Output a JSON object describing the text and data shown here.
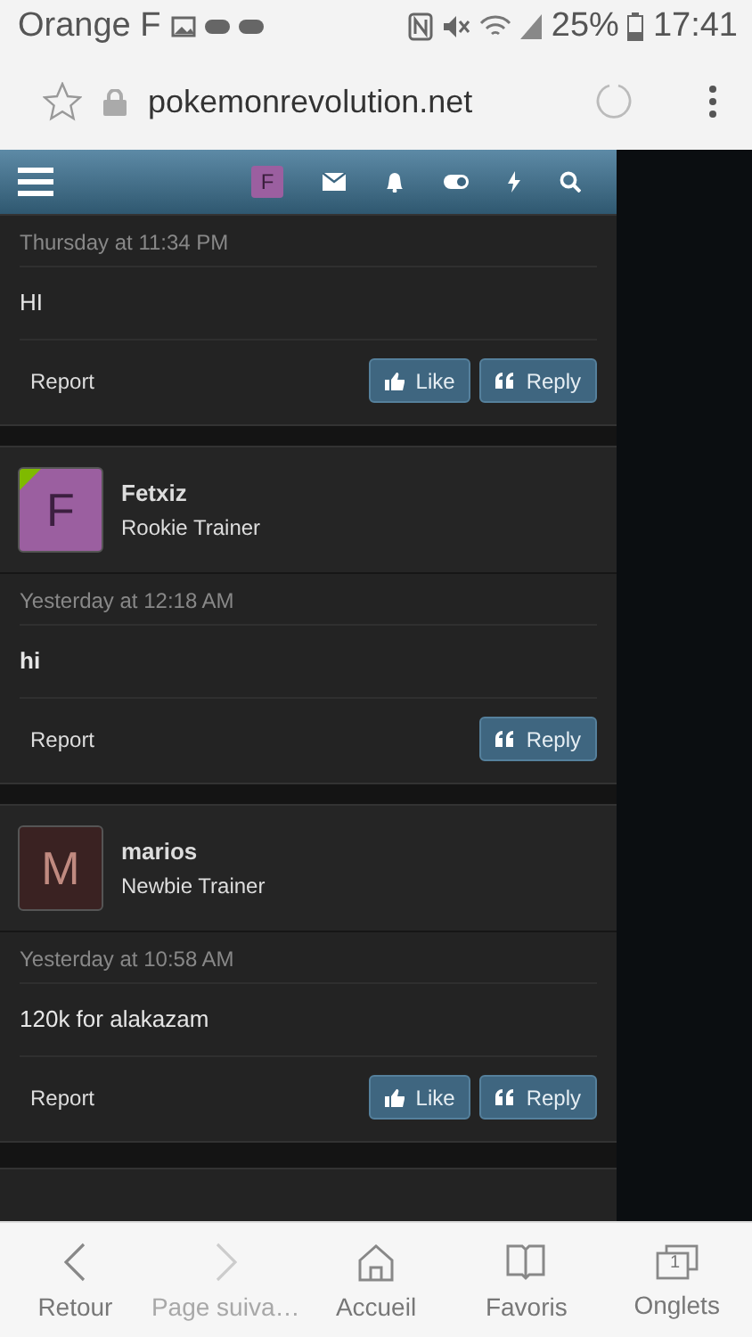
{
  "status_bar": {
    "carrier": "Orange F",
    "battery": "25%",
    "time": "17:41"
  },
  "browser": {
    "url": "pokemonrevolution.net"
  },
  "nav": {
    "avatar_letter": "F"
  },
  "posts": [
    {
      "date": "Thursday at 11:34 PM",
      "body": "HI",
      "report": "Report",
      "like": "Like",
      "reply": "Reply"
    },
    {
      "user": {
        "name": "Fetxiz",
        "title": "Rookie Trainer",
        "letter": "F",
        "color": "#9b5fa0",
        "online": true
      },
      "date": "Yesterday at 12:18 AM",
      "body": "hi",
      "body_bold": true,
      "report": "Report",
      "reply": "Reply"
    },
    {
      "user": {
        "name": "marios",
        "title": "Newbie Trainer",
        "letter": "M",
        "color": "#3a2222",
        "online": false
      },
      "date": "Yesterday at 10:58 AM",
      "body": "120k for alakazam",
      "report": "Report",
      "like": "Like",
      "reply": "Reply"
    }
  ],
  "bottom_bar": [
    {
      "kind": "back",
      "label": "Retour",
      "disabled": false
    },
    {
      "kind": "forward",
      "label": "Page suiva…",
      "disabled": true
    },
    {
      "kind": "home",
      "label": "Accueil",
      "disabled": false
    },
    {
      "kind": "bookmarks",
      "label": "Favoris",
      "disabled": false
    },
    {
      "kind": "tabs",
      "label": "Onglets",
      "disabled": false,
      "count": "1"
    }
  ]
}
